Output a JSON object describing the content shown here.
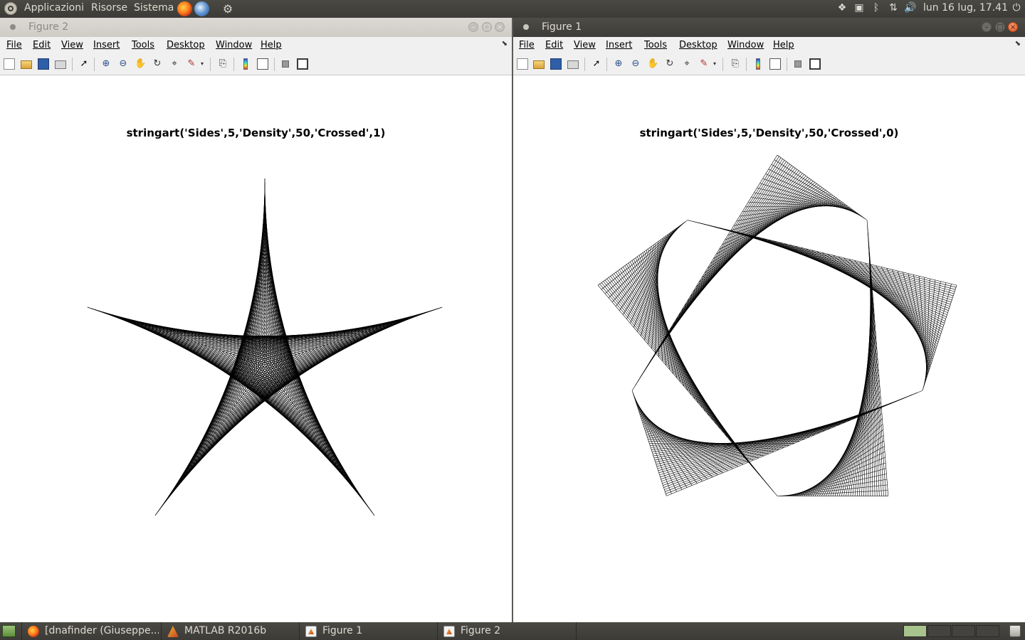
{
  "top_panel": {
    "menus": [
      "Applicazioni",
      "Risorse",
      "Sistema"
    ],
    "clock": "lun 16 lug, 17.41",
    "launchers": [
      "firefox-icon",
      "thunderbird-icon",
      "network-settings-icon"
    ],
    "tray_icons": [
      "dropbox-icon",
      "network-icon",
      "bluetooth-icon",
      "transfer-icon",
      "volume-icon"
    ]
  },
  "windows": [
    {
      "id": "left",
      "title": "Figure 2",
      "state": "inactive",
      "menu": [
        "File",
        "Edit",
        "View",
        "Insert",
        "Tools",
        "Desktop",
        "Window",
        "Help"
      ],
      "plot_title": "stringart('Sides',5,'Density',50,'Crossed',1)",
      "chart_data": {
        "type": "line",
        "title": "stringart('Sides',5,'Density',50,'Crossed',1)",
        "sides": 5,
        "density": 50,
        "crossed": 1,
        "grid": false,
        "color": "#000000"
      }
    },
    {
      "id": "right",
      "title": "Figure 1",
      "state": "active",
      "menu": [
        "File",
        "Edit",
        "View",
        "Insert",
        "Tools",
        "Desktop",
        "Window",
        "Help"
      ],
      "plot_title": "stringart('Sides',5,'Density',50,'Crossed',0)",
      "chart_data": {
        "type": "line",
        "title": "stringart('Sides',5,'Density',50,'Crossed',0)",
        "sides": 5,
        "density": 50,
        "crossed": 0,
        "grid": false,
        "color": "#000000"
      }
    }
  ],
  "toolbar_icons": [
    "new-figure-icon",
    "open-file-icon",
    "save-figure-icon",
    "print-figure-icon",
    "edit-plot-icon",
    "zoom-in-icon",
    "zoom-out-icon",
    "pan-icon",
    "rotate-3d-icon",
    "data-cursor-icon",
    "brush-icon",
    "brush-dropdown-icon",
    "link-plot-icon",
    "insert-colorbar-icon",
    "insert-legend-icon",
    "hide-plot-tools-icon",
    "show-plot-tools-icon"
  ],
  "taskbar": {
    "tasks": [
      {
        "label": "[dnafinder (Giuseppe...",
        "icon": "firefox-icon"
      },
      {
        "label": "MATLAB R2016b",
        "icon": "matlab-icon"
      },
      {
        "label": "Figure 1",
        "icon": "figure-icon"
      },
      {
        "label": "Figure 2",
        "icon": "figure-icon"
      }
    ],
    "workspace_count": 4,
    "active_workspace": 1
  },
  "colors": {
    "panel": "#3c3b37",
    "panel_text": "#dfdbd2",
    "menubar": "#f0f0f0",
    "close_button": "#e2531f"
  }
}
